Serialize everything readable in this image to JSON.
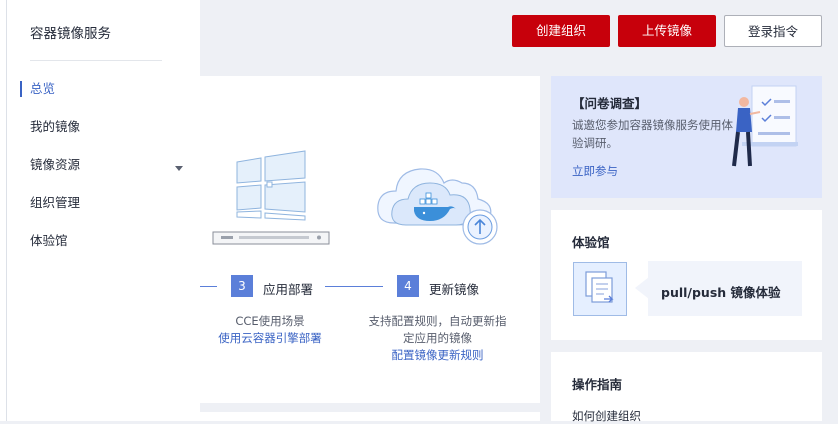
{
  "sidebar": {
    "title": "容器镜像服务",
    "items": [
      {
        "label": "总览",
        "active": true
      },
      {
        "label": "我的镜像"
      },
      {
        "label": "镜像资源"
      },
      {
        "label": "组织管理"
      },
      {
        "label": "体验馆"
      }
    ]
  },
  "toolbar": {
    "create_org": "创建组织",
    "upload_image": "上传镜像",
    "login_cmd": "登录指令"
  },
  "steps": [
    {
      "num": "3",
      "label": "应用部署",
      "desc": "CCE使用场景",
      "link": "使用云容器引擎部署"
    },
    {
      "num": "4",
      "label": "更新镜像",
      "desc_line1": "支持配置规则，自动更新指",
      "desc_line2": "定应用的镜像",
      "link": "配置镜像更新规则"
    }
  ],
  "survey": {
    "title": "【问卷调查】",
    "desc": "诚邀您参加容器镜像服务使用体验调研。",
    "link": "立即参与"
  },
  "experience": {
    "title": "体验馆",
    "panel_label": "pull/push 镜像体验"
  },
  "guide": {
    "title": "操作指南",
    "first_item": "如何创建组织"
  },
  "colors": {
    "brand_red": "#c7000b",
    "accent_blue": "#5b7fd9",
    "link_blue": "#3a63c4"
  }
}
